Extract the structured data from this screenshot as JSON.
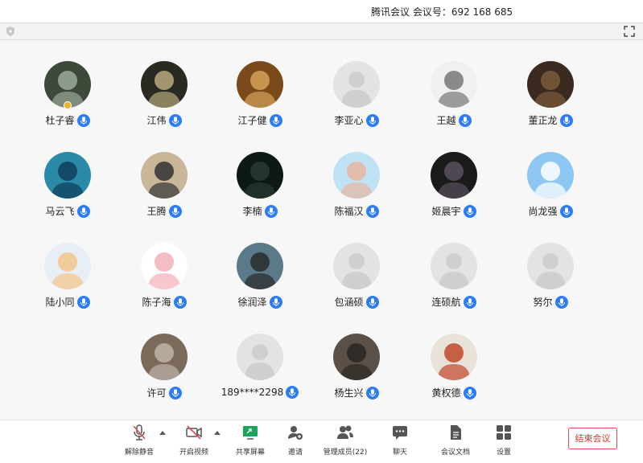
{
  "window": {
    "title": "腾讯会议 会议号：692 168 685"
  },
  "icons": {
    "shield": "shield-icon",
    "fullscreen": "fullscreen-icon",
    "mic": "mic-icon"
  },
  "colors": {
    "accent": "#2b7cf6",
    "end_meeting": "#d8322f",
    "host_badge": "#f2b12c"
  },
  "participants": [
    {
      "name": "杜子睿",
      "host": true
    },
    {
      "name": "江伟"
    },
    {
      "name": "江子健"
    },
    {
      "name": "李亚心"
    },
    {
      "name": "王越"
    },
    {
      "name": "董正龙"
    },
    {
      "name": "马云飞"
    },
    {
      "name": "王腾"
    },
    {
      "name": "李楠"
    },
    {
      "name": "陈福汉"
    },
    {
      "name": "姬晨宇"
    },
    {
      "name": "尚龙强"
    },
    {
      "name": "陆小同"
    },
    {
      "name": "陈子海"
    },
    {
      "name": "徐润泽"
    },
    {
      "name": "包涵硕"
    },
    {
      "name": "连硕航"
    },
    {
      "name": "努尔"
    },
    {
      "name": "许可"
    },
    {
      "name": "189****2298"
    },
    {
      "name": "杨生兴"
    },
    {
      "name": "黄权德"
    }
  ],
  "bottom_bar": {
    "mute": "解除静音",
    "video": "开启视频",
    "share": "共享屏幕",
    "invite": "邀请",
    "members": "管理成员(22)",
    "chat": "聊天",
    "docs": "会议文档",
    "settings": "设置",
    "end": "结束会议"
  }
}
